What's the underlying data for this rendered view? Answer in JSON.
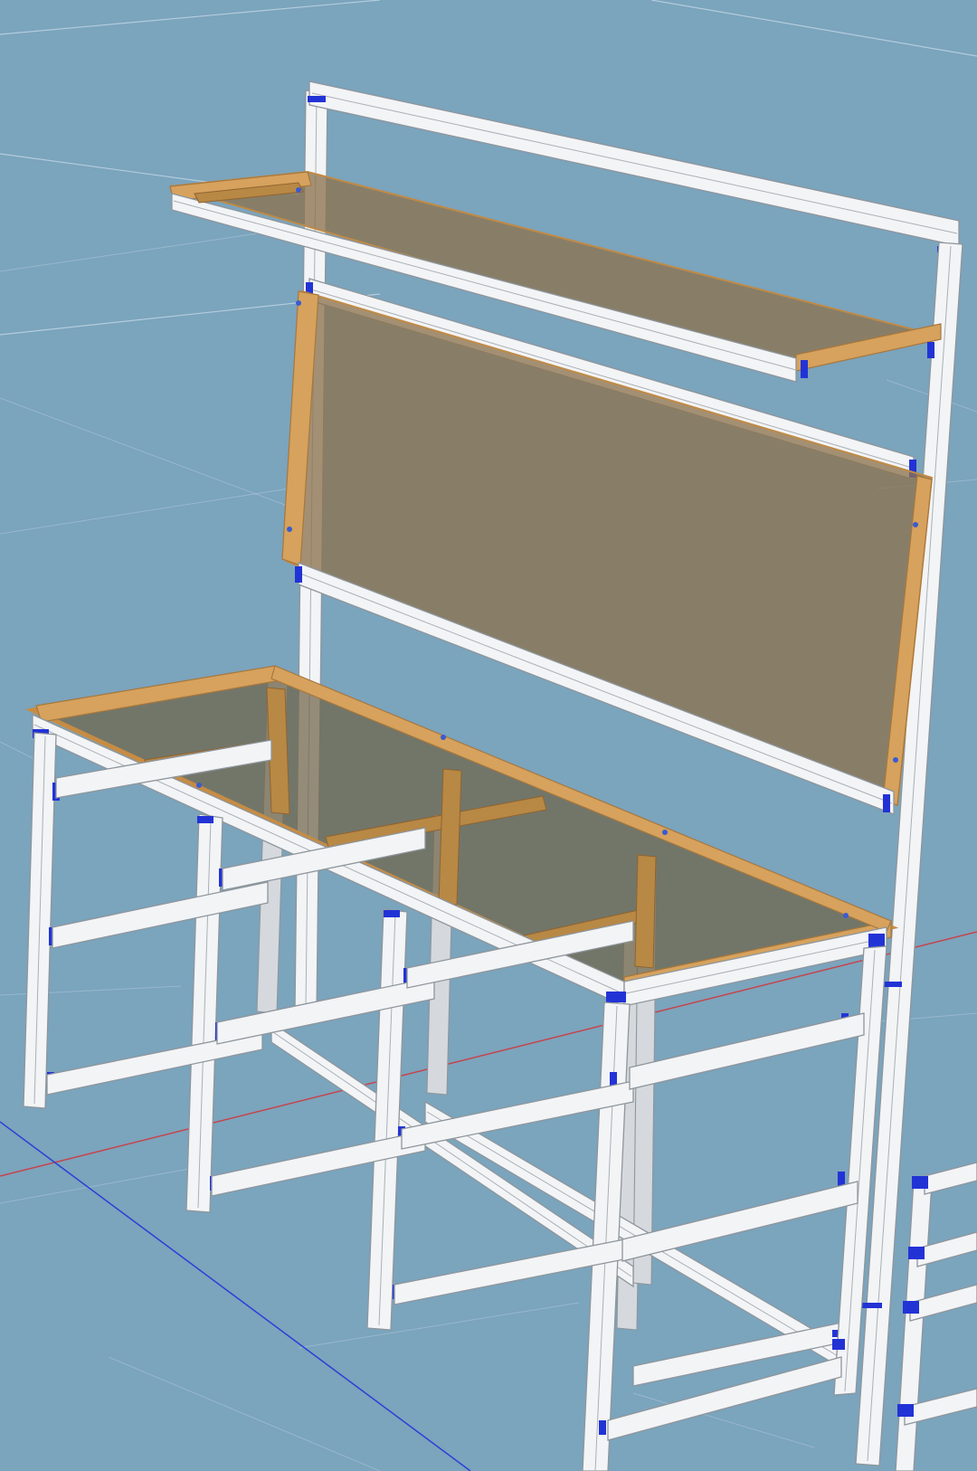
{
  "viewport": {
    "background_color": "#7ba4bd",
    "grid_color": "#e1eef5",
    "x_axis_color": "#c8434a",
    "y_axis_color": "#2c3fd6"
  },
  "model": {
    "profile_color": "#f3f4f6",
    "panel_color": "#8c7350",
    "wood_edge_color": "#c78c43",
    "bracket_color": "#2233d6"
  }
}
